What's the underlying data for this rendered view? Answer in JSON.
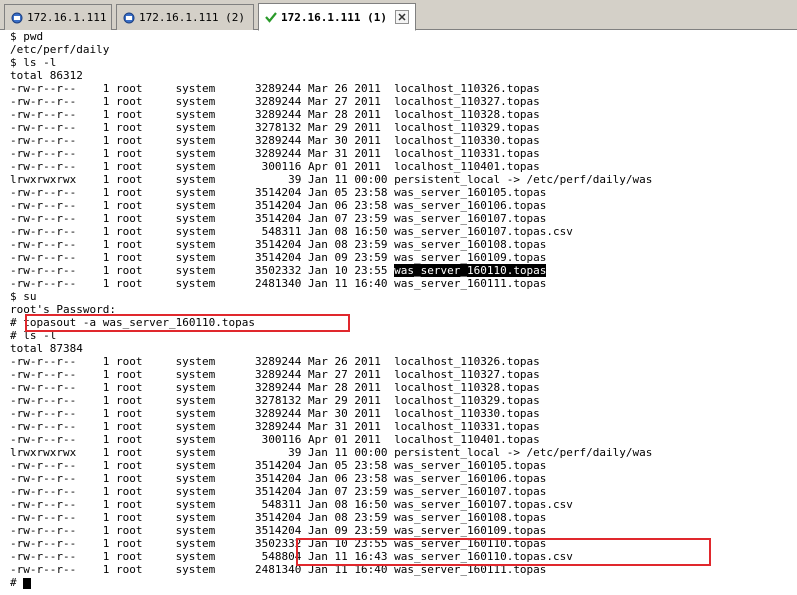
{
  "tabs": [
    {
      "label": "172.16.1.111",
      "icon": "session-icon"
    },
    {
      "label": "172.16.1.111 (2)",
      "icon": "session-icon"
    },
    {
      "label": "172.16.1.111 (1)",
      "icon": "check-icon",
      "active": true
    }
  ],
  "terminal": {
    "lines": [
      "$ pwd",
      "/etc/perf/daily",
      "$ ls -l",
      "total 86312",
      "-rw-r--r--    1 root     system      3289244 Mar 26 2011  localhost_110326.topas",
      "-rw-r--r--    1 root     system      3289244 Mar 27 2011  localhost_110327.topas",
      "-rw-r--r--    1 root     system      3289244 Mar 28 2011  localhost_110328.topas",
      "-rw-r--r--    1 root     system      3278132 Mar 29 2011  localhost_110329.topas",
      "-rw-r--r--    1 root     system      3289244 Mar 30 2011  localhost_110330.topas",
      "-rw-r--r--    1 root     system      3289244 Mar 31 2011  localhost_110331.topas",
      "-rw-r--r--    1 root     system       300116 Apr 01 2011  localhost_110401.topas",
      "lrwxrwxrwx    1 root     system           39 Jan 11 00:00 persistent_local -> /etc/perf/daily/was",
      "-rw-r--r--    1 root     system      3514204 Jan 05 23:58 was_server_160105.topas",
      "-rw-r--r--    1 root     system      3514204 Jan 06 23:58 was_server_160106.topas",
      "-rw-r--r--    1 root     system      3514204 Jan 07 23:59 was_server_160107.topas",
      "-rw-r--r--    1 root     system       548311 Jan 08 16:50 was_server_160107.topas.csv",
      "-rw-r--r--    1 root     system      3514204 Jan 08 23:59 was_server_160108.topas",
      "-rw-r--r--    1 root     system      3514204 Jan 09 23:59 was_server_160109.topas",
      "-rw-r--r--    1 root     system      3502332 Jan 10 23:55 ",
      "-rw-r--r--    1 root     system      2481340 Jan 11 16:40 was_server_160111.topas",
      "$ su",
      "root's Password:",
      "# ",
      "# ls -l",
      "total 87384",
      "-rw-r--r--    1 root     system      3289244 Mar 26 2011  localhost_110326.topas",
      "-rw-r--r--    1 root     system      3289244 Mar 27 2011  localhost_110327.topas",
      "-rw-r--r--    1 root     system      3289244 Mar 28 2011  localhost_110328.topas",
      "-rw-r--r--    1 root     system      3278132 Mar 29 2011  localhost_110329.topas",
      "-rw-r--r--    1 root     system      3289244 Mar 30 2011  localhost_110330.topas",
      "-rw-r--r--    1 root     system      3289244 Mar 31 2011  localhost_110331.topas",
      "-rw-r--r--    1 root     system       300116 Apr 01 2011  localhost_110401.topas",
      "lrwxrwxrwx    1 root     system           39 Jan 11 00:00 persistent_local -> /etc/perf/daily/was",
      "-rw-r--r--    1 root     system      3514204 Jan 05 23:58 was_server_160105.topas",
      "-rw-r--r--    1 root     system      3514204 Jan 06 23:58 was_server_160106.topas",
      "-rw-r--r--    1 root     system      3514204 Jan 07 23:59 was_server_160107.topas",
      "-rw-r--r--    1 root     system       548311 Jan 08 16:50 was_server_160107.topas.csv",
      "-rw-r--r--    1 root     system      3514204 Jan 08 23:59 was_server_160108.topas",
      "-rw-r--r--    1 root     system      3514204 Jan 09 23:59 was_server_160109.topas",
      "-rw-r--r--    1 root     system      3502332 Jan 10 23:55 was_server_160110.topas",
      "-rw-r--r--    1 root     system       548804 Jan 11 16:43 was_server_160110.topas.csv",
      "-rw-r--r--    1 root     system      2481340 Jan 11 16:40 was_server_160111.topas",
      "# "
    ],
    "highlighted_filename": "was_server_160110.topas",
    "command": "topasout -a was_server_160110.topas"
  },
  "annotation_color": "#e0282d"
}
